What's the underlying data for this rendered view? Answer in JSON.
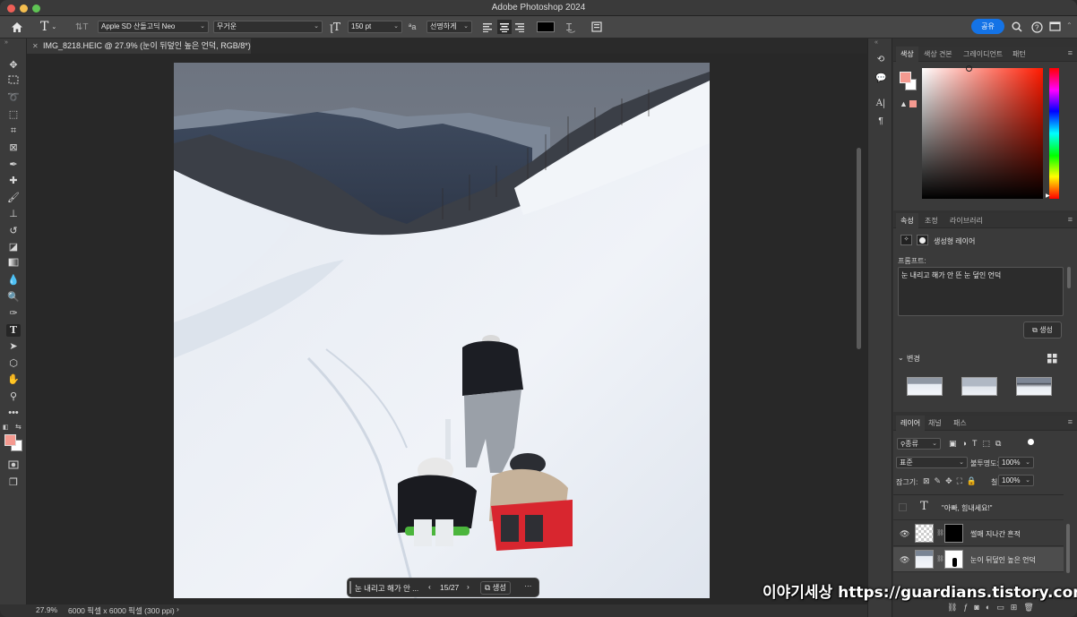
{
  "app": {
    "title": "Adobe Photoshop 2024"
  },
  "options_bar": {
    "font_family": "Apple SD 산돌고딕 Neo",
    "font_weight": "무거운",
    "font_size": "150 pt",
    "antialias_icon": "ªa",
    "antialias": "선명하게",
    "share_label": "공유"
  },
  "document": {
    "tab_title": "IMG_8218.HEIC @ 27.9% (눈이 뒤덮인 높은 언덕, RGB/8*) *"
  },
  "status": {
    "zoom": "27.9%",
    "dimensions": "6000 픽셀 x 6000 픽셀 (300 ppi)",
    "arrow": "›"
  },
  "taskbar": {
    "prompt": "눈 내리고 해가 안 ...",
    "count": "15/27",
    "prev": "‹",
    "next": "›",
    "generate": "생성",
    "more": "···"
  },
  "color_panel": {
    "tabs": [
      "색상",
      "색상 견본",
      "그레이디언트",
      "패턴"
    ],
    "foreground": "#f59a90",
    "background": "#ffffff"
  },
  "properties_panel": {
    "tabs": [
      "속성",
      "조정",
      "라이브러리"
    ],
    "layer_type": "생성형 레이어",
    "prompt_label": "프롬프트:",
    "prompt_value": "눈 내리고 해가 안 뜬 눈 덮인 언덕",
    "generate": "생성",
    "variations_label": "변경"
  },
  "layers_panel": {
    "tabs": [
      "레이어",
      "채널",
      "패스"
    ],
    "filter": "종류",
    "blend_mode": "표준",
    "opacity_label": "불투명도:",
    "opacity": "100%",
    "lock_label": "잠그기:",
    "fill_label": "칠:",
    "fill": "100%",
    "layers": [
      {
        "name": "\"아빠, 힘내세요!\"",
        "type": "text",
        "visible": false
      },
      {
        "name": "썰매 지나간 흔적",
        "type": "generative",
        "visible": true
      },
      {
        "name": "눈이 뒤덮인 높은 언덕",
        "type": "generative",
        "visible": true,
        "selected": true
      }
    ]
  },
  "watermark": "이야기세상 https://guardians.tistory.com"
}
